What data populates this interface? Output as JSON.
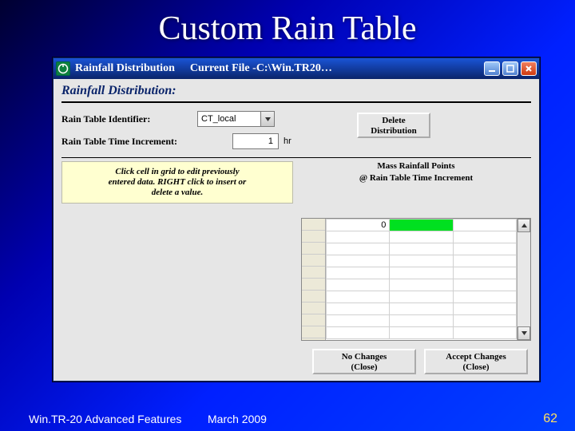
{
  "slide": {
    "title": "Custom Rain Table",
    "footer_left": "Win.TR-20 Advanced Features",
    "footer_mid": "March 2009",
    "page_number": "62"
  },
  "window": {
    "title": "Rainfall Distribution",
    "current_file_label": "Current File - ",
    "current_file_path": "C:\\Win.TR20…",
    "subheader": "Rainfall Distribution:",
    "labels": {
      "identifier": "Rain Table Identifier:",
      "increment": "Rain Table Time Increment:",
      "increment_unit": "hr"
    },
    "identifier_value": "CT_local",
    "increment_value": "1",
    "delete_btn_l1": "Delete",
    "delete_btn_l2": "Distribution",
    "tip_l1": "Click cell in grid to edit previously",
    "tip_l2": "entered data. RIGHT click to insert or",
    "tip_l3": "delete  a value.",
    "mass_l1": "Mass Rainfall Points",
    "mass_l2": "@ Rain Table Time Increment",
    "grid_first_value": "0",
    "no_changes_l1": "No Changes",
    "no_changes_l2": "(Close)",
    "accept_l1": "Accept Changes",
    "accept_l2": "(Close)"
  }
}
